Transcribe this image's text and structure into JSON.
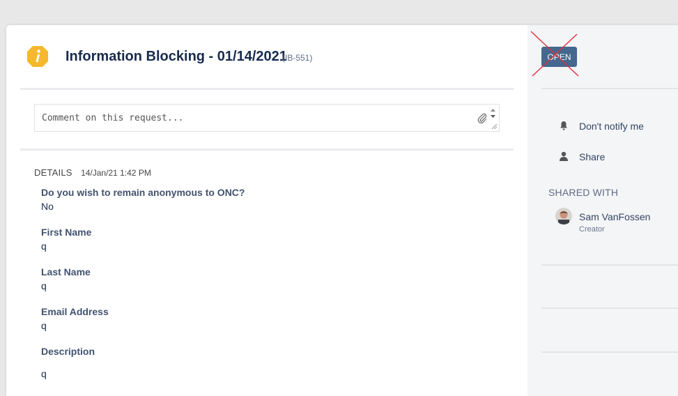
{
  "request": {
    "title": "Information Blocking - 01/14/2021",
    "key": "(IB-551)"
  },
  "comment": {
    "placeholder": "Comment on this request..."
  },
  "details": {
    "label": "DETAILS",
    "date": "14/Jan/21 1:42 PM",
    "fields": [
      {
        "label": "Do you wish to remain anonymous to ONC?",
        "value": "No"
      },
      {
        "label": "First Name",
        "value": "q"
      },
      {
        "label": "Last Name",
        "value": "q"
      },
      {
        "label": "Email Address",
        "value": "q"
      },
      {
        "label": "Description",
        "value": "q"
      }
    ]
  },
  "sidebar": {
    "status": "OPEN",
    "notify_label": "Don't notify me",
    "share_label": "Share",
    "shared_with_title": "SHARED WITH",
    "shared_with": [
      {
        "name": "Sam VanFossen",
        "role": "Creator"
      }
    ]
  },
  "colors": {
    "status_button": "#44688e",
    "request_type_icon": "#f5b82e",
    "cross_mark": "#e0303a"
  },
  "icons": [
    "info-icon",
    "paperclip-icon",
    "bell-icon",
    "person-icon"
  ]
}
